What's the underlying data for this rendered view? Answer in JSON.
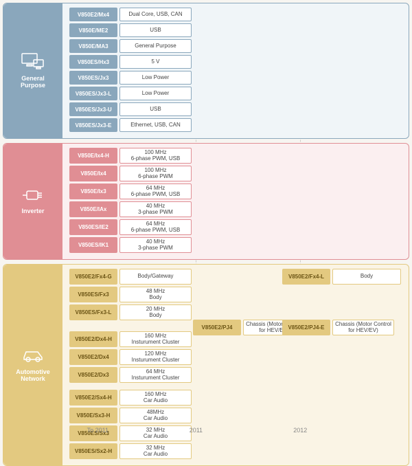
{
  "timeline": {
    "labels": [
      "To 2011",
      "2011",
      "2012"
    ]
  },
  "categories": {
    "general_purpose": {
      "title": "General\nPurpose",
      "rows": [
        {
          "part": "V850E2/Mx4",
          "desc": "Dual Core, USB, CAN"
        },
        {
          "part": "V850E/ME2",
          "desc": "USB"
        },
        {
          "part": "V850E/MA3",
          "desc": "General Purpose"
        },
        {
          "part": "V850ES/Hx3",
          "desc": "5 V"
        },
        {
          "part": "V850ES/Jx3",
          "desc": "Low Power"
        },
        {
          "part": "V850ES/Jx3-L",
          "desc": "Low Power"
        },
        {
          "part": "V850ES/Jx3-U",
          "desc": "USB"
        },
        {
          "part": "V850ES/Jx3-E",
          "desc": "Ethernet, USB, CAN"
        }
      ]
    },
    "inverter": {
      "title": "Inverter",
      "rows": [
        {
          "part": "V850E/Ix4-H",
          "desc": "100 MHz\n6-phase PWM, USB"
        },
        {
          "part": "V850E/Ix4",
          "desc": "100 MHz\n6-phase PWM"
        },
        {
          "part": "V850E/Ix3",
          "desc": "64 MHz\n6-phase PWM, USB"
        },
        {
          "part": "V850E/IAx",
          "desc": "40 MHz\n3-phase PWM"
        },
        {
          "part": "V850ES/IE2",
          "desc": "64 MHz\n6-phase PWM, USB"
        },
        {
          "part": "V850ES/IK1",
          "desc": "40 MHz\n3-phase PWM"
        }
      ]
    },
    "automotive": {
      "title": "Automotive\nNetwork",
      "groups": {
        "body": [
          {
            "part": "V850E2/Fx4-G",
            "desc": "Body/Gateway"
          },
          {
            "part": "V850ES/Fx3",
            "desc": "48 MHz\nBody"
          },
          {
            "part": "V850ES/Fx3-L",
            "desc": "20 MHz\nBody"
          }
        ],
        "cluster": [
          {
            "part": "V850E2/Dx4-H",
            "desc": "160 MHz\nInsturument Cluster"
          },
          {
            "part": "V850E2/Dx4",
            "desc": "120 MHz\nInsturument Cluster"
          },
          {
            "part": "V850E2/Dx3",
            "desc": "64 MHz\nInsturument Cluster"
          }
        ],
        "audio": [
          {
            "part": "V850E2/Sx4-H",
            "desc": "160 MHz\nCar Audio"
          },
          {
            "part": "V850E/Sx3-H",
            "desc": "48MHz\nCar Audio"
          },
          {
            "part": "V850ES/Sx3",
            "desc": "32 MHz\nCar Audio"
          },
          {
            "part": "V850ES/Sx2-H",
            "desc": "32 MHz\nCar Audio"
          }
        ]
      },
      "placed": {
        "fx4l": {
          "part": "V850E2/Fx4-L",
          "desc": "Body"
        },
        "pj4": {
          "part": "V850E2/PJ4",
          "desc": "Chassis  (Motor Control for HEV/EV)"
        },
        "pj4e": {
          "part": "V850E2/PJ4-E",
          "desc": "Chassis  (Motor Control for HEV/EV)"
        }
      }
    }
  }
}
